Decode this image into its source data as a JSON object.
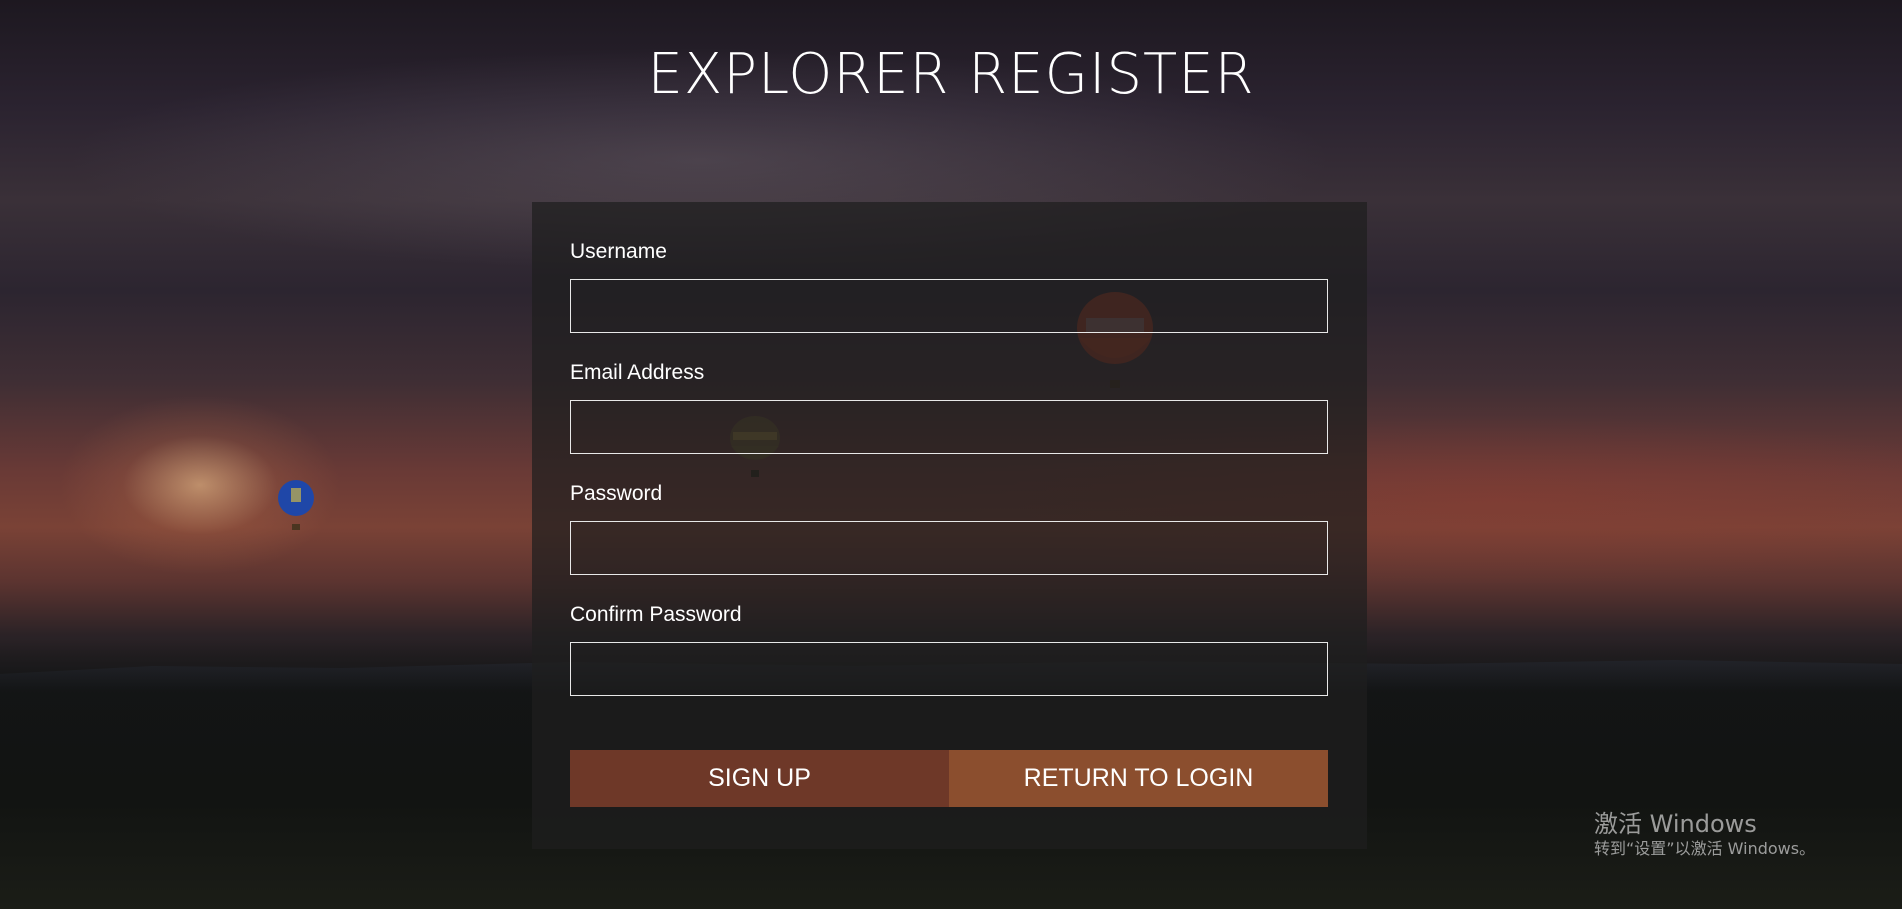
{
  "page": {
    "title": "EXPLORER REGISTER"
  },
  "form": {
    "fields": [
      {
        "label": "Username",
        "value": "",
        "type": "text"
      },
      {
        "label": "Email Address",
        "value": "",
        "type": "email"
      },
      {
        "label": "Password",
        "value": "",
        "type": "password"
      },
      {
        "label": "Confirm Password",
        "value": "",
        "type": "password"
      }
    ],
    "signup_label": "SIGN UP",
    "return_label": "RETURN TO LOGIN"
  },
  "colors": {
    "signup_button": "#6e3828",
    "return_button": "#8b4e2e",
    "panel_background": "rgba(30,30,30,0.72)"
  },
  "background": {
    "icons": [
      "hot-air-balloon-icon",
      "sun-icon"
    ]
  },
  "watermark": {
    "title": "激活 Windows",
    "subtitle": "转到“设置”以激活 Windows。"
  }
}
